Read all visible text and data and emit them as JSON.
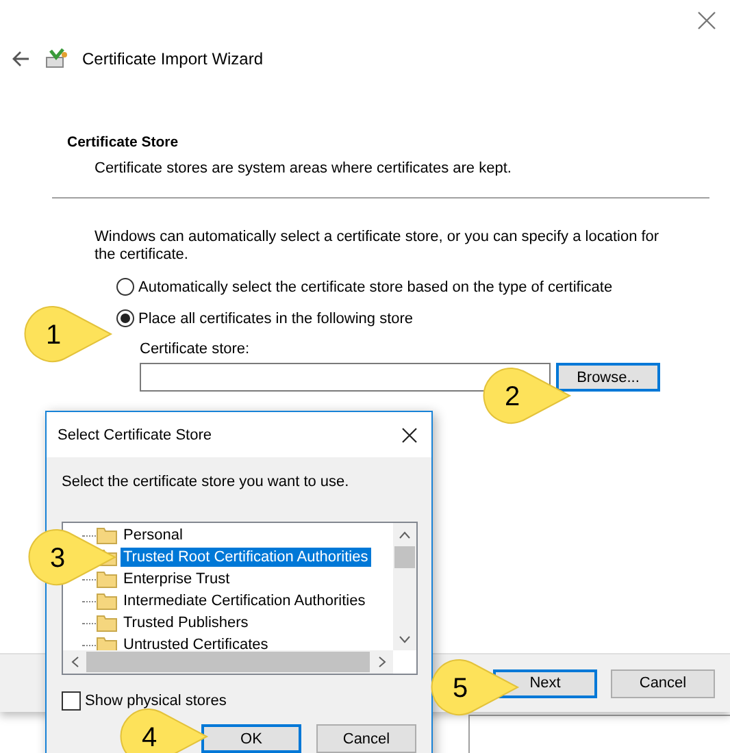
{
  "window": {
    "title": "Certificate Import Wizard"
  },
  "section": {
    "title": "Certificate Store",
    "description": "Certificate stores are system areas where certificates are kept."
  },
  "intro": "Windows can automatically select a certificate store, or you can specify a location for the certificate.",
  "radios": [
    {
      "label": "Automatically select the certificate store based on the type of certificate",
      "selected": false
    },
    {
      "label": "Place all certificates in the following store",
      "selected": true
    }
  ],
  "store_field": {
    "label": "Certificate store:"
  },
  "browse_button": {
    "label": "Browse...",
    "default": true
  },
  "footer_buttons": [
    {
      "label": "Next",
      "default": true
    },
    {
      "label": "Cancel",
      "default": false
    }
  ],
  "dialog": {
    "title": "Select Certificate Store",
    "instruction": "Select the certificate store you want to use.",
    "items": [
      {
        "label": "Personal",
        "selected": false
      },
      {
        "label": "Trusted Root Certification Authorities",
        "selected": true
      },
      {
        "label": "Enterprise Trust",
        "selected": false
      },
      {
        "label": "Intermediate Certification Authorities",
        "selected": false
      },
      {
        "label": "Trusted Publishers",
        "selected": false
      },
      {
        "label": "Untrusted Certificates",
        "selected": false
      }
    ],
    "checkbox": {
      "label": "Show physical stores",
      "checked": false
    },
    "buttons": [
      {
        "label": "OK",
        "default": true
      },
      {
        "label": "Cancel",
        "default": false
      }
    ]
  },
  "callouts": [
    "1",
    "2",
    "3",
    "4",
    "5"
  ]
}
